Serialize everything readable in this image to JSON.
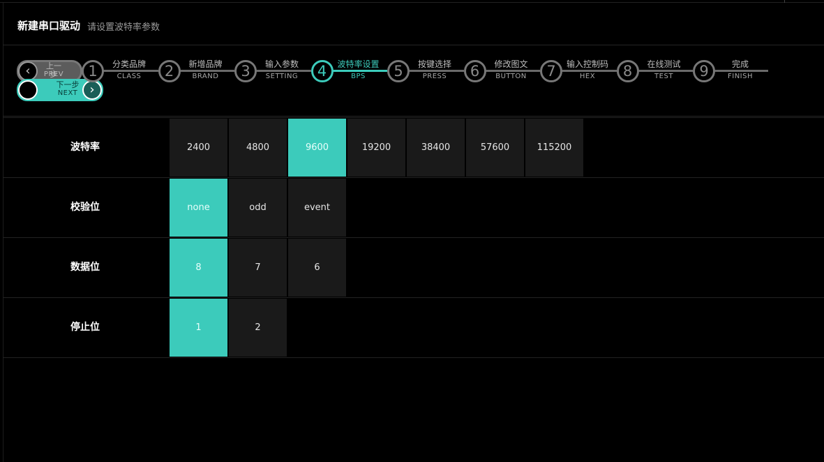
{
  "header": {
    "title": "新建串口驱动",
    "subtitle": "请设置波特率参数"
  },
  "nav": {
    "prev": {
      "label": "上一步",
      "sub": "PREV"
    },
    "next": {
      "label": "下一步",
      "sub": "NEXT"
    }
  },
  "steps": [
    {
      "num": "1",
      "label": "分类品牌",
      "sub": "CLASS",
      "active": false
    },
    {
      "num": "2",
      "label": "新增品牌",
      "sub": "BRAND",
      "active": false
    },
    {
      "num": "3",
      "label": "输入参数",
      "sub": "SETTING",
      "active": false
    },
    {
      "num": "4",
      "label": "波特率设置",
      "sub": "BPS",
      "active": true
    },
    {
      "num": "5",
      "label": "按键选择",
      "sub": "PRESS",
      "active": false
    },
    {
      "num": "6",
      "label": "修改图文",
      "sub": "BUTTON",
      "active": false
    },
    {
      "num": "7",
      "label": "输入控制码",
      "sub": "HEX",
      "active": false
    },
    {
      "num": "8",
      "label": "在线测试",
      "sub": "TEST",
      "active": false
    },
    {
      "num": "9",
      "label": "完成",
      "sub": "FINISH",
      "active": false
    }
  ],
  "params": [
    {
      "label": "波特率",
      "options": [
        "2400",
        "4800",
        "9600",
        "19200",
        "38400",
        "57600",
        "115200"
      ],
      "selected": "9600"
    },
    {
      "label": "校验位",
      "options": [
        "none",
        "odd",
        "event"
      ],
      "selected": "none"
    },
    {
      "label": "数据位",
      "options": [
        "8",
        "7",
        "6"
      ],
      "selected": "8"
    },
    {
      "label": "停止位",
      "options": [
        "1",
        "2"
      ],
      "selected": "1"
    }
  ],
  "colors": {
    "accent": "#3ccbbb",
    "background": "#000000",
    "tile": "#1a1a1a"
  }
}
